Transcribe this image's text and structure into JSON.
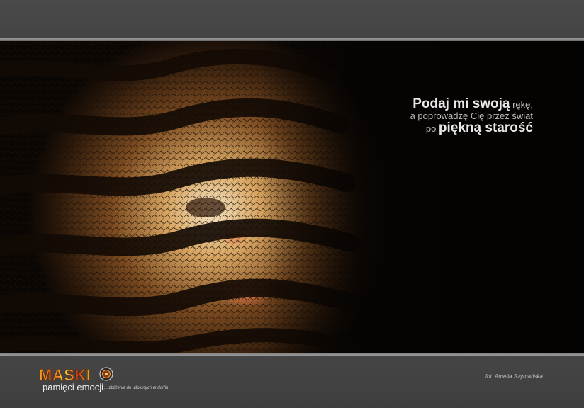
{
  "quote": {
    "line1_bold": "Podaj mi swoją",
    "line1_rest": " rękę,",
    "line2": "a poprowadzę Cię przez świat",
    "line3_pre": "po ",
    "line3_bold": "piękną starość"
  },
  "credit": "fot. Amelia Szymańska",
  "logo": {
    "word": "MASKI",
    "subtitle": "pamięci emocji",
    "tagline": "... zbliżenie do uśpionych endorfin"
  },
  "colors": {
    "frame": "#464646",
    "rule": "#8a8a8a",
    "photo_dark": "#050302",
    "fabric_warm": "#c8843a",
    "skin_glow": "#d86a3a",
    "text": "#e0e0e0"
  }
}
